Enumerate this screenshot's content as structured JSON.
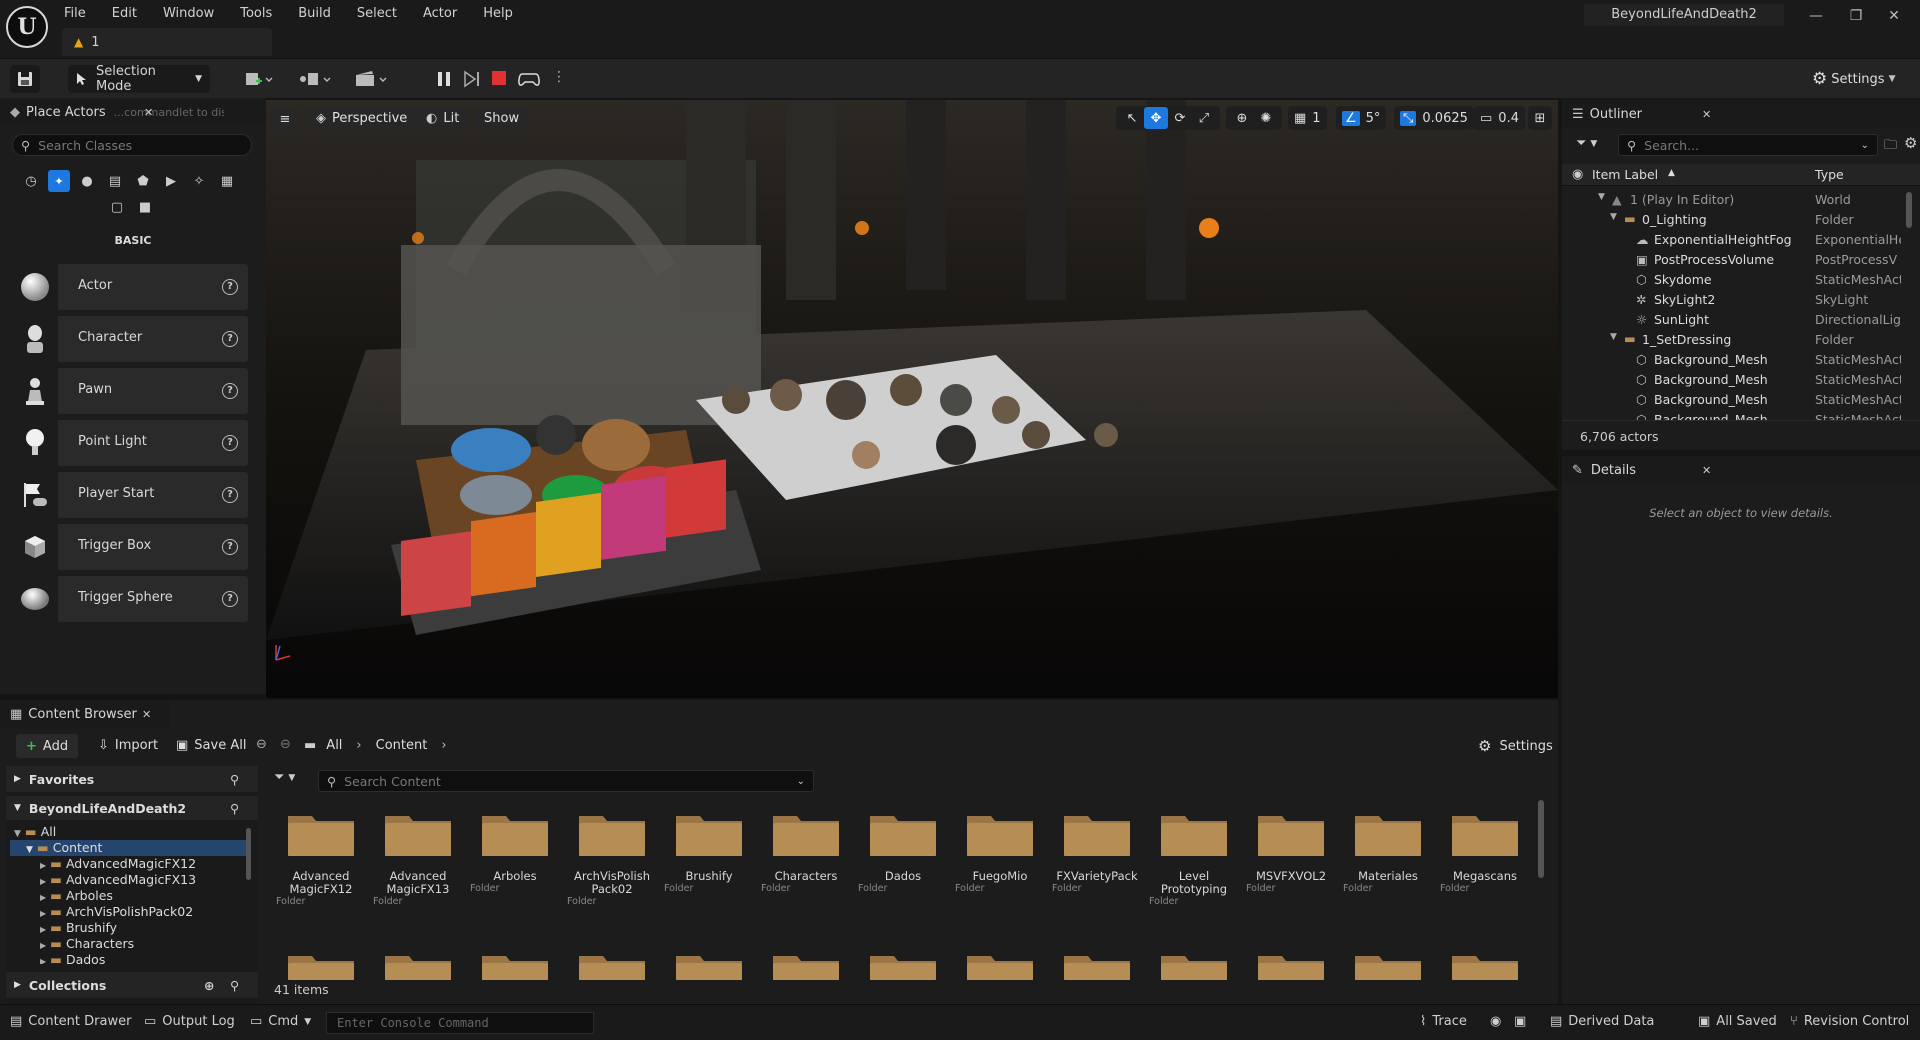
{
  "menu": {
    "items": [
      "File",
      "Edit",
      "Window",
      "Tools",
      "Build",
      "Select",
      "Actor",
      "Help"
    ],
    "level_tab": "1",
    "project_name": "BeyondLifeAndDeath2"
  },
  "toolbar": {
    "selection_mode": "Selection Mode",
    "settings": "Settings"
  },
  "place_actors": {
    "tab_title": "Place Actors",
    "search_placeholder": "Search Classes",
    "category": "BASIC",
    "tooltip_fragment": "...commandlet to disk (Ctrl+S)",
    "items": [
      {
        "label": "Actor",
        "icon": "sphere-icon"
      },
      {
        "label": "Character",
        "icon": "character-icon"
      },
      {
        "label": "Pawn",
        "icon": "pawn-icon"
      },
      {
        "label": "Point Light",
        "icon": "light-bulb-icon"
      },
      {
        "label": "Player Start",
        "icon": "player-start-icon"
      },
      {
        "label": "Trigger Box",
        "icon": "cube-icon"
      },
      {
        "label": "Trigger Sphere",
        "icon": "sphere-icon"
      }
    ]
  },
  "viewport": {
    "perspective": "Perspective",
    "lit": "Lit",
    "show": "Show",
    "grid_snap": "1",
    "rotation_snap": "5°",
    "scale_snap": "0.0625",
    "camera_speed": "0.4"
  },
  "outliner": {
    "tab_title": "Outliner",
    "search_placeholder": "Search...",
    "col_label": "Item Label",
    "col_type": "Type",
    "rows": [
      {
        "label": "1 (Play In Editor)",
        "type": "World"
      },
      {
        "label": "0_Lighting",
        "type": "Folder"
      },
      {
        "label": "ExponentialHeightFog",
        "type": "ExponentialHe"
      },
      {
        "label": "PostProcessVolume",
        "type": "PostProcessV"
      },
      {
        "label": "Skydome",
        "type": "StaticMeshAct"
      },
      {
        "label": "SkyLight2",
        "type": "SkyLight"
      },
      {
        "label": "SunLight",
        "type": "DirectionalLigh"
      },
      {
        "label": "1_SetDressing",
        "type": "Folder"
      },
      {
        "label": "Background_Mesh",
        "type": "StaticMeshAct"
      },
      {
        "label": "Background_Mesh",
        "type": "StaticMeshAct"
      },
      {
        "label": "Background_Mesh",
        "type": "StaticMeshAct"
      },
      {
        "label": "Background_Mesh",
        "type": "StaticMeshAct"
      }
    ],
    "count": "6,706 actors"
  },
  "details": {
    "tab_title": "Details",
    "empty_text": "Select an object to view details."
  },
  "content_browser": {
    "tab_title": "Content Browser",
    "add": "Add",
    "import": "Import",
    "save_all": "Save All",
    "breadcrumb": [
      "All",
      "Content"
    ],
    "settings": "Settings",
    "favorites": "Favorites",
    "project": "BeyondLifeAndDeath2",
    "collections": "Collections",
    "search_placeholder": "Search Content",
    "tree": [
      "All",
      "Content",
      "AdvancedMagicFX12",
      "AdvancedMagicFX13",
      "Arboles",
      "ArchVisPolishPack02",
      "Brushify",
      "Characters",
      "Dados"
    ],
    "folders": [
      {
        "name": "Advanced MagicFX12",
        "type": "Folder"
      },
      {
        "name": "Advanced MagicFX13",
        "type": "Folder"
      },
      {
        "name": "Arboles",
        "type": "Folder"
      },
      {
        "name": "ArchVisPolish Pack02",
        "type": "Folder"
      },
      {
        "name": "Brushify",
        "type": "Folder"
      },
      {
        "name": "Characters",
        "type": "Folder"
      },
      {
        "name": "Dados",
        "type": "Folder"
      },
      {
        "name": "FuegoMio",
        "type": "Folder"
      },
      {
        "name": "FXVarietyPack",
        "type": "Folder"
      },
      {
        "name": "Level Prototyping",
        "type": "Folder"
      },
      {
        "name": "MSVFXVOL2",
        "type": "Folder"
      },
      {
        "name": "Materiales",
        "type": "Folder"
      },
      {
        "name": "Megascans",
        "type": "Folder"
      }
    ],
    "item_count": "41 items"
  },
  "statusbar": {
    "content_drawer": "Content Drawer",
    "output_log": "Output Log",
    "cmd": "Cmd",
    "console_placeholder": "Enter Console Command",
    "trace": "Trace",
    "derived_data": "Derived Data",
    "all_saved": "All Saved",
    "revision_control": "Revision Control"
  },
  "colors": {
    "accent": "#1d79e0",
    "folder": "#b78d56",
    "stop": "#e03232",
    "warning": "#e8a317"
  }
}
